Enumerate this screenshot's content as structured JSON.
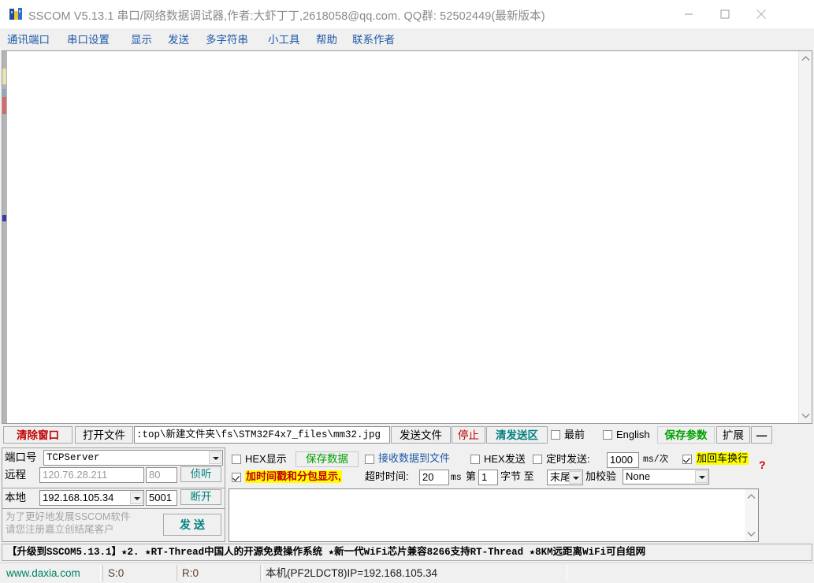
{
  "window": {
    "title": "SSCOM V5.13.1 串口/网络数据调试器,作者:大虾丁丁,2618058@qq.com. QQ群: 52502449(最新版本)",
    "minimize": "minimize-icon",
    "maximize": "maximize-icon",
    "close": "close-icon"
  },
  "menu": {
    "items": [
      {
        "label": "通讯端口"
      },
      {
        "label": "串口设置"
      },
      {
        "label": "显示"
      },
      {
        "label": "发送"
      },
      {
        "label": "多字符串"
      },
      {
        "label": "小工具"
      },
      {
        "label": "帮助"
      },
      {
        "label": "联系作者"
      }
    ]
  },
  "receive": {
    "content": "",
    "scroll_up": "chevron-up-icon",
    "scroll_down": "chevron-down-icon"
  },
  "toolbar": {
    "clear_window": "清除窗口",
    "open_file": "打开文件",
    "file_path": ":top\\新建文件夹\\fs\\STM32F4x7_files\\mm32.jpg",
    "send_file": "发送文件",
    "stop": "停止",
    "clear_send": "清发送区",
    "topmost_label": "最前",
    "topmost_checked": false,
    "english_label": "English",
    "english_checked": false,
    "save_params": "保存参数",
    "extend": "扩展",
    "collapse": "—"
  },
  "settings": {
    "port_label": "端口号",
    "port_value": "TCPServer",
    "remote_label": "远程",
    "remote_ip": "120.76.28.211",
    "remote_port": "80",
    "listen_button": "侦听",
    "local_label": "本地",
    "local_ip": "192.168.105.34",
    "local_port": "5001",
    "disconnect_button": "断开",
    "promo_line1": "为了更好地发展SSCOM软件",
    "promo_line2": "请您注册嘉立创结尾客户",
    "send_button": "发  送"
  },
  "options": {
    "hex_display_label": "HEX显示",
    "hex_display_checked": false,
    "save_data_label": "保存数据",
    "recv_to_file_label": "接收数据到文件",
    "recv_to_file_checked": false,
    "hex_send_label": "HEX发送",
    "hex_send_checked": false,
    "timed_send_label": "定时发送:",
    "timed_send_checked": false,
    "timed_send_value": "1000",
    "timed_send_unit": "ms/次",
    "crlf_label": "加回车换行",
    "crlf_checked": true,
    "help_marker": "?",
    "timestamp_label": "加时间戳和分包显示,",
    "timestamp_checked": true,
    "timeout_label": "超时时间:",
    "timeout_value": "20",
    "timeout_unit": "ms",
    "byte_from_label": "第",
    "byte_from_value": "1",
    "byte_unit_label": "字节 至",
    "byte_to_value": "末尾",
    "checksum_label": "加校验",
    "checksum_value": "None",
    "send_text": ""
  },
  "banner": {
    "text": "【升级到SSCOM5.13.1】★2.  ★RT-Thread中国人的开源免费操作系统 ★新一代WiFi芯片兼容8266支持RT-Thread ★8KM远距离WiFi可自组网"
  },
  "status": {
    "site": "www.daxia.com",
    "sent": "S:0",
    "received": "R:0",
    "host_info": "本机(PF2LDCT8)IP=192.168.105.34"
  },
  "colors": {
    "accent_blue": "#1e5aa8",
    "red": "#c00000",
    "teal": "#008080",
    "green": "#00a000",
    "highlight": "#ffff00"
  }
}
